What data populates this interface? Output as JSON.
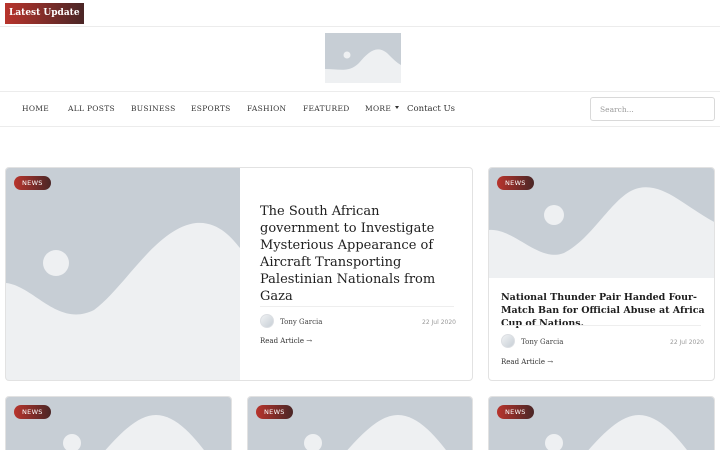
{
  "topbar": {
    "latest_label": "Latest  Update"
  },
  "logo": {
    "alt": "site-logo-placeholder"
  },
  "nav": {
    "items": [
      "HOME",
      "ALL POSTS",
      "BUSINESS",
      "ESPORTS",
      "FASHION",
      "FEATURED",
      "MORE",
      "Contact Us"
    ]
  },
  "search": {
    "placeholder": "Search..."
  },
  "colors": {
    "accent_start": "#b8342c",
    "accent_end": "#4a2626",
    "placeholder_bg": "#c7ced5"
  },
  "articles": [
    {
      "category": "NEWS",
      "title": "The South African government to Investigate Mysterious Appearance of Aircraft Transporting Palestinian Nationals from Gaza",
      "author": "Tony Garcia",
      "date": "22 Jul 2020",
      "read_more": "Read Article  →"
    },
    {
      "category": "NEWS",
      "title": "National Thunder Pair Handed Four-Match Ban for Official Abuse at Africa Cup of Nations.",
      "author": "Tony Garcia",
      "date": "22 Jul 2020",
      "read_more": "Read Article  →"
    },
    {
      "category": "NEWS"
    },
    {
      "category": "NEWS"
    },
    {
      "category": "NEWS"
    }
  ]
}
